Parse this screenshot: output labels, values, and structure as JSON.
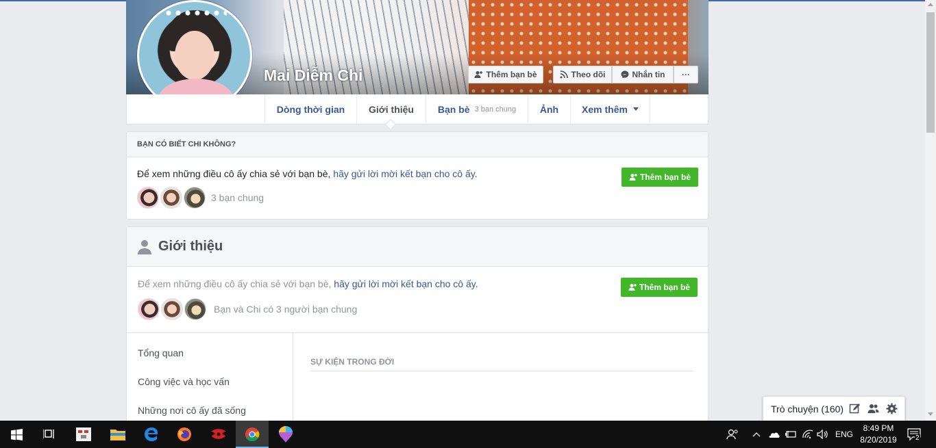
{
  "profile": {
    "name": "Mai Diễm Chi",
    "actions": {
      "add_friend": "Thêm bạn bè",
      "follow": "Theo dõi",
      "message": "Nhắn tin",
      "more": "···"
    }
  },
  "nav": {
    "timeline": "Dòng thời gian",
    "about": "Giới thiệu",
    "friends": "Bạn bè",
    "friends_sub": "3 bạn chung",
    "photos": "Ảnh",
    "more": "Xem thêm"
  },
  "know_card": {
    "title": "BẠN CÓ BIẾT CHI KHÔNG?",
    "text": "Để xem những điều cô ấy chia sẻ với bạn bè,",
    "link": "hãy gửi lời mời kết bạn cho cô ấy.",
    "button": "Thêm bạn bè",
    "mutual": "3 bạn chung"
  },
  "intro": {
    "title": "Giới thiệu",
    "text": "Để xem những điều cô ấy chia sẻ với bạn bè,",
    "link": "hãy gửi lời mời kết bạn cho cô ấy.",
    "button": "Thêm bạn bè",
    "mutual": "Bạn và Chi có 3 người bạn chung",
    "sidebar": [
      "Tổng quan",
      "Công việc và học vấn",
      "Những nơi cô ấy đã sống"
    ],
    "events_title": "SỰ KIỆN TRONG ĐỜI"
  },
  "chat": {
    "label": "Trò chuyện (160)"
  },
  "taskbar": {
    "language": "ENG",
    "time": "8:49 PM",
    "date": "8/20/2019",
    "notifications": "2"
  }
}
